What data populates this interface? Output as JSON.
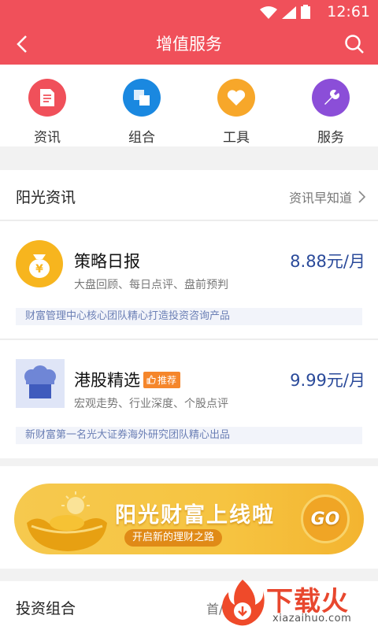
{
  "status_bar": {
    "time": "12:61"
  },
  "title_bar": {
    "title": "增值服务"
  },
  "categories": [
    {
      "label": "资讯",
      "color": "#f0505a",
      "icon": "document-icon"
    },
    {
      "label": "组合",
      "color": "#1a88e0",
      "icon": "stack-icon"
    },
    {
      "label": "工具",
      "color": "#f7a72a",
      "icon": "heart-icon"
    },
    {
      "label": "服务",
      "color": "#8b4ed8",
      "icon": "wrench-icon"
    }
  ],
  "section_info": {
    "title": "阳光资讯",
    "link": "资讯早知道"
  },
  "products": [
    {
      "name": "策略日报",
      "price": "8.88元/月",
      "desc": "大盘回顾、每日点评、盘前预判",
      "note": "财富管理中心核心团队精心打造投资咨询产品"
    },
    {
      "name": "港股精选",
      "badge": "推荐",
      "price": "9.99元/月",
      "desc": "宏观走势、行业深度、个股点评",
      "note": "新财富第一名光大证券海外研究团队精心出品"
    }
  ],
  "banner": {
    "headline": "阳光财富上线啦",
    "sub": "开启新的理财之路",
    "go": "GO"
  },
  "section_portfolio": {
    "title": "投资组合",
    "link": "首/"
  },
  "watermark": {
    "text": "下载火",
    "url": "xiazaihuo.com"
  }
}
